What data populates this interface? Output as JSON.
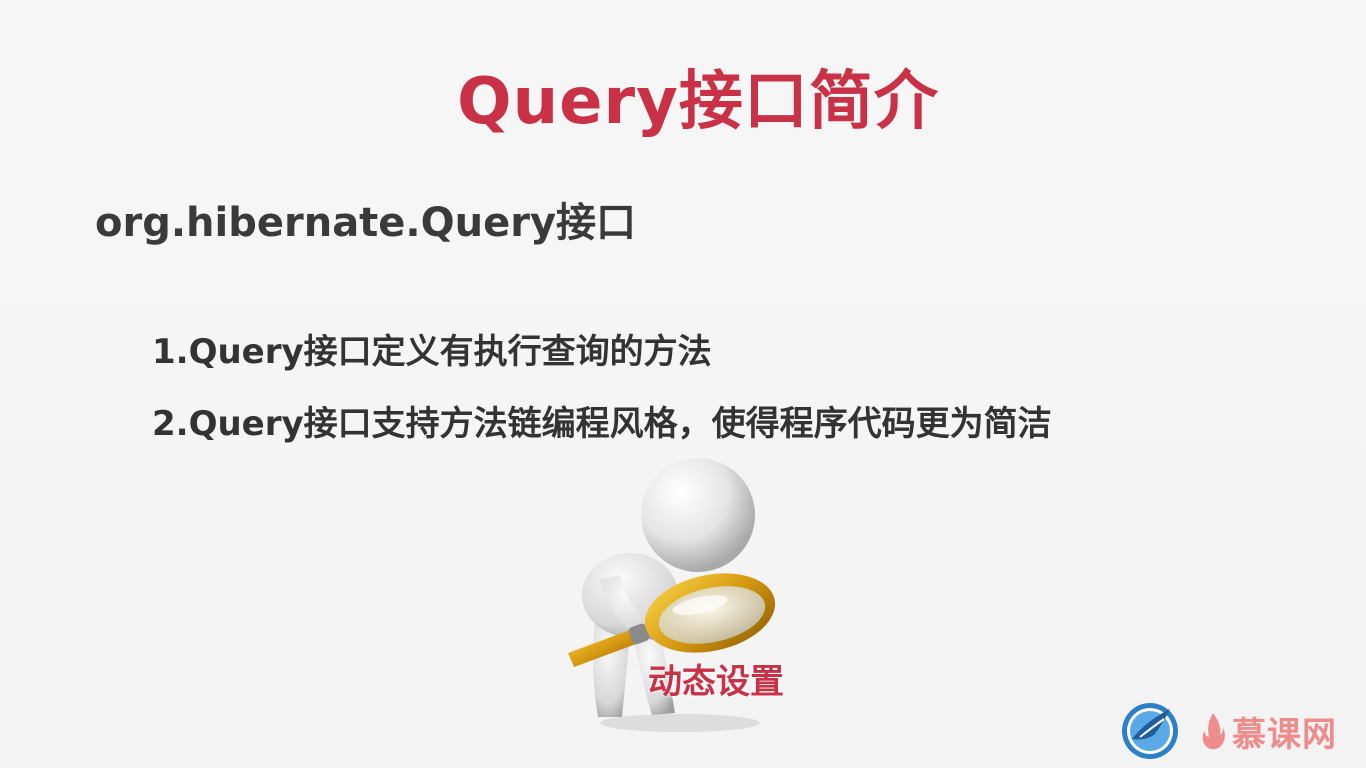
{
  "slide": {
    "title": "Query接口简介",
    "subtitle": "org.hibernate.Query接口",
    "points": [
      "1.Query接口定义有执行查询的方法",
      "2.Query接口支持方法链编程风格，使得程序代码更为简洁"
    ],
    "figure_caption": "动态设置",
    "figure_icon": "magnifier-person-figure"
  },
  "watermark": {
    "text": "慕课网",
    "icon": "imooc-bird-logo",
    "color": "#ee8b8b"
  },
  "colors": {
    "title": "#c83146",
    "body_text": "#333333",
    "background": "#f6f6f6"
  }
}
